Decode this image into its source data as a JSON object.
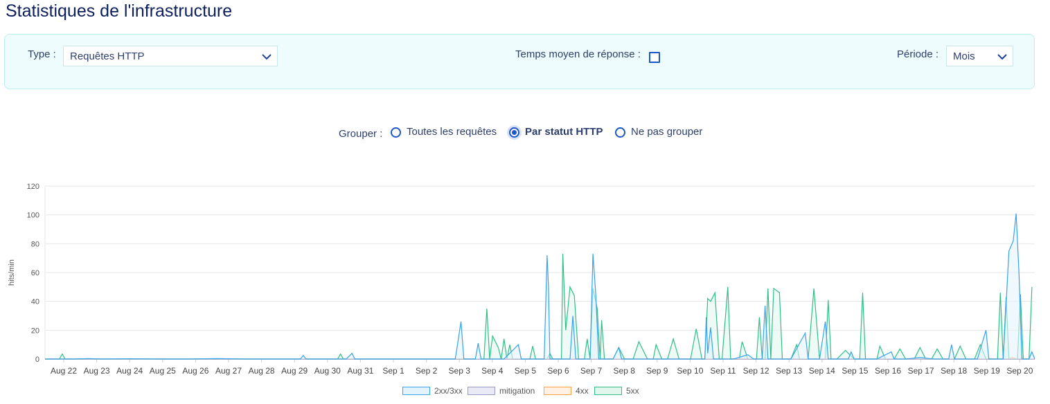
{
  "page": {
    "title": "Statistiques de l'infrastructure"
  },
  "filters": {
    "type_label": "Type :",
    "type_value": "Requêtes HTTP",
    "avg_label": "Temps moyen de réponse :",
    "avg_checked": false,
    "period_label": "Période :",
    "period_value": "Mois"
  },
  "group": {
    "label": "Grouper :",
    "options": [
      {
        "label": "Toutes les requêtes",
        "selected": false
      },
      {
        "label": "Par statut HTTP",
        "selected": true
      },
      {
        "label": "Ne pas grouper",
        "selected": false
      }
    ]
  },
  "chart_data": {
    "type": "area",
    "ylabel": "hits/min",
    "ylim": [
      0,
      120
    ],
    "yticks": [
      0,
      20,
      40,
      60,
      80,
      100,
      120
    ],
    "xlabels": [
      "Aug 22",
      "Aug 23",
      "Aug 24",
      "Aug 25",
      "Aug 26",
      "Aug 27",
      "Aug 28",
      "Aug 29",
      "Aug 30",
      "Aug 31",
      "Sep 1",
      "Sep 2",
      "Sep 3",
      "Sep 4",
      "Sep 5",
      "Sep 6",
      "Sep 7",
      "Sep 8",
      "Sep 9",
      "Sep 10",
      "Sep 11",
      "Sep 12",
      "Sep 13",
      "Sep 14",
      "Sep 15",
      "Sep 16",
      "Sep 17",
      "Sep 18",
      "Sep 19",
      "Sep 20"
    ],
    "x_range_days": [
      0,
      30
    ],
    "grid": true,
    "legend_position": "bottom",
    "series": [
      {
        "name": "2xx/3xx",
        "color": "#36a2eb",
        "fill": "#e3f3fc",
        "points": [
          [
            0,
            0
          ],
          [
            1,
            0
          ],
          [
            1.5,
            0.3
          ],
          [
            2,
            0
          ],
          [
            3,
            0.2
          ],
          [
            4,
            0
          ],
          [
            5,
            0
          ],
          [
            6,
            0.3
          ],
          [
            7,
            0
          ],
          [
            8,
            0
          ],
          [
            8.9,
            0
          ],
          [
            9,
            2.5
          ],
          [
            9.1,
            0
          ],
          [
            10.5,
            0
          ],
          [
            10.7,
            4
          ],
          [
            10.8,
            0
          ],
          [
            13,
            0
          ],
          [
            14.3,
            0
          ],
          [
            14.5,
            26
          ],
          [
            14.6,
            0
          ],
          [
            15,
            0
          ],
          [
            15.1,
            11
          ],
          [
            15.2,
            0
          ],
          [
            16,
            0
          ],
          [
            16.5,
            10
          ],
          [
            16.6,
            0
          ],
          [
            17.4,
            0
          ],
          [
            17.5,
            72
          ],
          [
            17.55,
            50
          ],
          [
            17.6,
            0
          ],
          [
            18.3,
            0
          ],
          [
            18.4,
            30
          ],
          [
            18.5,
            0
          ],
          [
            19,
            0
          ],
          [
            19.1,
            73
          ],
          [
            19.2,
            44
          ],
          [
            19.3,
            0
          ],
          [
            19.8,
            0
          ],
          [
            20,
            8
          ],
          [
            20.1,
            0
          ],
          [
            21,
            0
          ],
          [
            22,
            0
          ],
          [
            23,
            0
          ],
          [
            23.05,
            29
          ],
          [
            23.1,
            4
          ],
          [
            23.2,
            22
          ],
          [
            23.3,
            0
          ],
          [
            24,
            0
          ],
          [
            24.5,
            3
          ],
          [
            24.7,
            0
          ],
          [
            25,
            0
          ],
          [
            25.1,
            37
          ],
          [
            25.2,
            0
          ],
          [
            26,
            0
          ],
          [
            26.5,
            18
          ],
          [
            26.6,
            0
          ],
          [
            27,
            0
          ],
          [
            27.2,
            26
          ],
          [
            27.3,
            0
          ],
          [
            28,
            0
          ],
          [
            28.1,
            5
          ],
          [
            28.2,
            0
          ],
          [
            29,
            0
          ],
          [
            29.5,
            5
          ],
          [
            29.6,
            0
          ],
          [
            30,
            0
          ],
          [
            30.5,
            1
          ],
          [
            31,
            0
          ],
          [
            31.5,
            0
          ],
          [
            31.6,
            10
          ],
          [
            31.7,
            0
          ],
          [
            32,
            0
          ],
          [
            32.5,
            0
          ],
          [
            32.8,
            20
          ],
          [
            32.9,
            0
          ],
          [
            33,
            0
          ],
          [
            33.4,
            0
          ],
          [
            33.6,
            75
          ],
          [
            33.75,
            82
          ],
          [
            33.85,
            101
          ],
          [
            33.95,
            60
          ],
          [
            34.05,
            0
          ],
          [
            34.3,
            0
          ],
          [
            34.4,
            5
          ],
          [
            34.5,
            0
          ]
        ]
      },
      {
        "name": "mitigation",
        "color": "#9999cc",
        "fill": "#eaeaf6",
        "points": [
          [
            0,
            0
          ],
          [
            34.5,
            0
          ]
        ]
      },
      {
        "name": "4xx",
        "color": "#ff9f40",
        "fill": "#fff1e3",
        "points": [
          [
            0,
            0
          ],
          [
            33.6,
            0
          ],
          [
            33.7,
            1
          ],
          [
            33.9,
            0
          ],
          [
            34.5,
            0
          ]
        ]
      },
      {
        "name": "5xx",
        "color": "#2fbf86",
        "fill": "#e2f6ee",
        "points": [
          [
            0,
            0
          ],
          [
            0.5,
            0
          ],
          [
            0.6,
            3.5
          ],
          [
            0.7,
            0
          ],
          [
            2,
            0
          ],
          [
            10.2,
            0
          ],
          [
            10.3,
            3.5
          ],
          [
            10.4,
            0
          ],
          [
            14.8,
            0
          ],
          [
            15.3,
            0
          ],
          [
            15.4,
            35
          ],
          [
            15.5,
            0
          ],
          [
            15.6,
            16
          ],
          [
            15.8,
            8
          ],
          [
            15.9,
            0
          ],
          [
            16,
            14
          ],
          [
            16.1,
            0
          ],
          [
            16.2,
            10
          ],
          [
            16.3,
            0
          ],
          [
            16.9,
            0
          ],
          [
            17,
            9
          ],
          [
            17.1,
            0
          ],
          [
            17.5,
            0
          ],
          [
            17.6,
            4
          ],
          [
            17.7,
            0
          ],
          [
            18,
            0
          ],
          [
            18.05,
            73
          ],
          [
            18.15,
            20
          ],
          [
            18.3,
            50
          ],
          [
            18.45,
            44
          ],
          [
            18.6,
            0
          ],
          [
            18.8,
            0
          ],
          [
            18.9,
            14
          ],
          [
            19,
            0
          ],
          [
            19.1,
            49
          ],
          [
            19.25,
            35
          ],
          [
            19.35,
            0
          ],
          [
            19.4,
            27
          ],
          [
            19.5,
            0
          ],
          [
            19.8,
            0
          ],
          [
            20,
            8
          ],
          [
            20.2,
            0
          ],
          [
            20.5,
            0
          ],
          [
            20.7,
            12
          ],
          [
            21,
            0
          ],
          [
            21.2,
            0
          ],
          [
            21.3,
            10
          ],
          [
            21.5,
            0
          ],
          [
            21.7,
            0
          ],
          [
            21.9,
            14
          ],
          [
            22.1,
            0
          ],
          [
            22.5,
            0
          ],
          [
            22.7,
            21
          ],
          [
            22.9,
            0
          ],
          [
            23,
            0
          ],
          [
            23.1,
            42
          ],
          [
            23.2,
            40
          ],
          [
            23.35,
            46
          ],
          [
            23.5,
            0
          ],
          [
            23.6,
            0
          ],
          [
            23.8,
            50
          ],
          [
            23.9,
            0
          ],
          [
            24.2,
            0
          ],
          [
            24.3,
            12
          ],
          [
            24.5,
            0
          ],
          [
            24.8,
            0
          ],
          [
            24.9,
            29
          ],
          [
            25,
            0
          ],
          [
            25.1,
            0
          ],
          [
            25.2,
            49
          ],
          [
            25.3,
            0
          ],
          [
            25.4,
            49
          ],
          [
            25.6,
            46
          ],
          [
            25.7,
            0
          ],
          [
            26,
            0
          ],
          [
            26.2,
            10
          ],
          [
            26.3,
            0
          ],
          [
            26.6,
            0
          ],
          [
            26.8,
            49
          ],
          [
            27,
            0
          ],
          [
            27.2,
            0
          ],
          [
            27.3,
            41
          ],
          [
            27.4,
            0
          ],
          [
            27.6,
            0
          ],
          [
            27.9,
            6
          ],
          [
            28.2,
            0
          ],
          [
            28.4,
            0
          ],
          [
            28.5,
            46
          ],
          [
            28.6,
            0
          ],
          [
            29,
            0
          ],
          [
            29.1,
            9
          ],
          [
            29.3,
            0
          ],
          [
            29.6,
            0
          ],
          [
            29.8,
            7
          ],
          [
            30,
            0
          ],
          [
            30.3,
            0
          ],
          [
            30.5,
            8
          ],
          [
            30.7,
            0
          ],
          [
            30.9,
            0
          ],
          [
            31.1,
            7
          ],
          [
            31.3,
            0
          ],
          [
            31.7,
            0
          ],
          [
            31.9,
            9
          ],
          [
            32.1,
            0
          ],
          [
            32.4,
            0
          ],
          [
            32.6,
            10
          ],
          [
            32.8,
            0
          ],
          [
            33.2,
            0
          ],
          [
            33.3,
            46
          ],
          [
            33.4,
            0
          ],
          [
            33.5,
            43
          ],
          [
            33.6,
            0
          ],
          [
            33.9,
            0
          ],
          [
            34,
            45
          ],
          [
            34.1,
            0
          ],
          [
            34.3,
            0
          ],
          [
            34.4,
            50
          ]
        ]
      }
    ]
  }
}
